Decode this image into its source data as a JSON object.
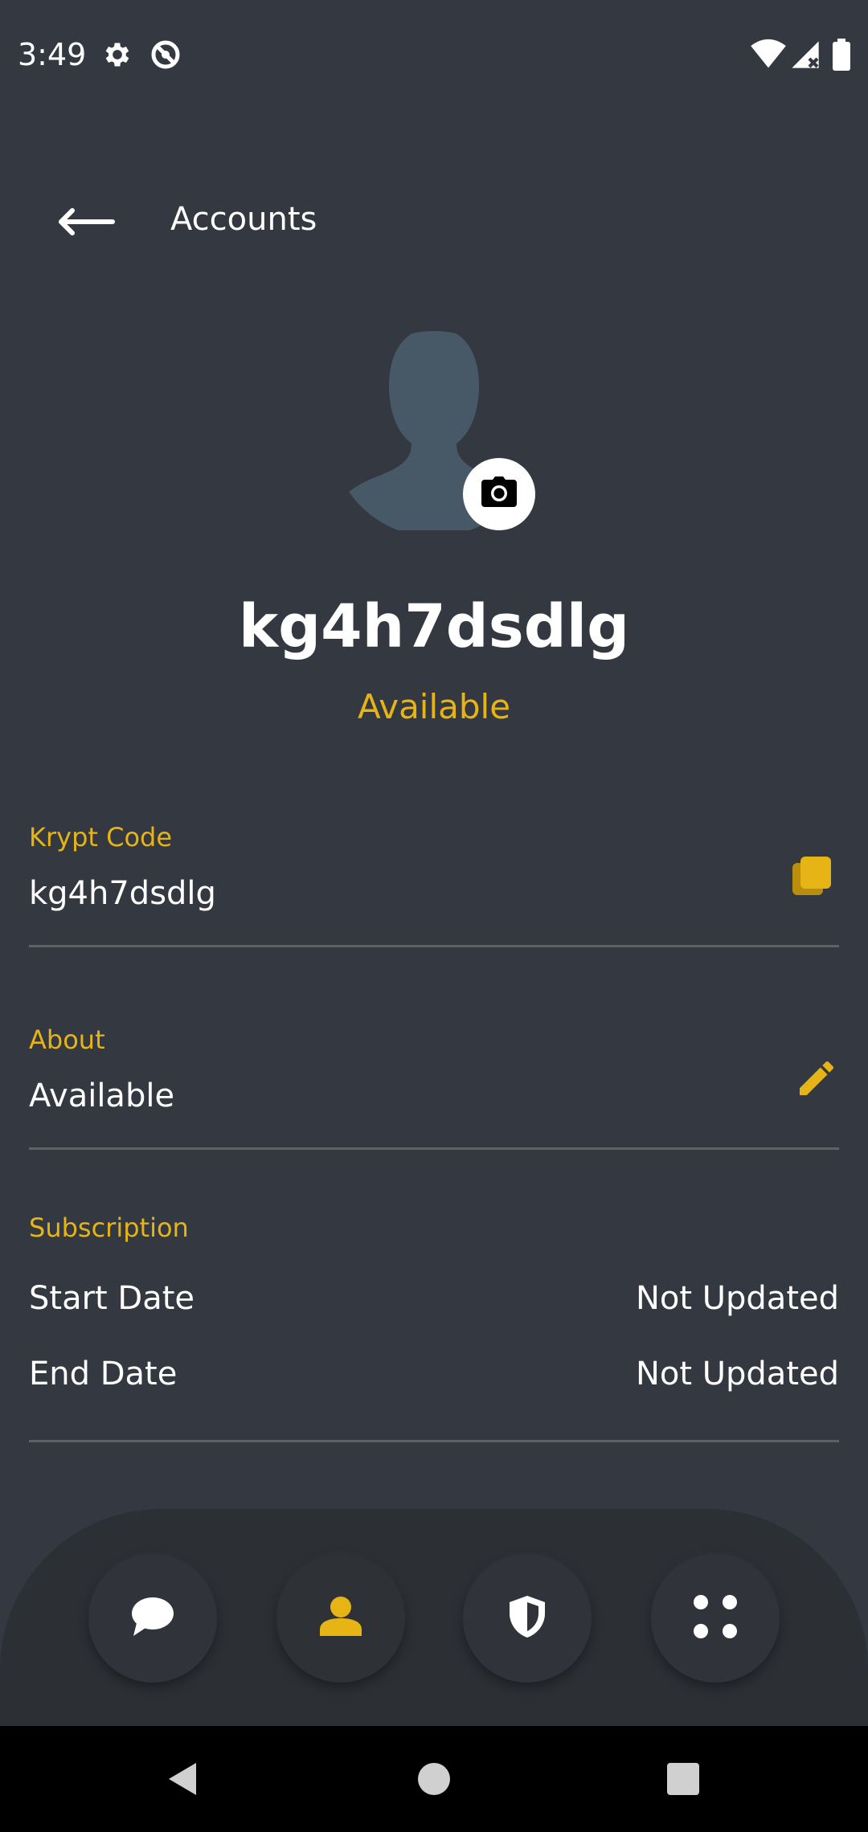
{
  "status_bar": {
    "time": "3:49",
    "icons_left": [
      "gear-icon",
      "no-signal-circle-icon"
    ],
    "icons_right": [
      "wifi-icon",
      "cell-signal-icon",
      "battery-icon"
    ]
  },
  "header": {
    "title": "Accounts",
    "back_icon": "arrow-left-icon"
  },
  "profile": {
    "name": "kg4h7dsdlg",
    "status": "Available",
    "avatar_icon": "person-silhouette-icon",
    "camera_icon": "camera-icon"
  },
  "krypt_code": {
    "label": "Krypt Code",
    "value": "kg4h7dsdlg",
    "action_icon": "copy-icon"
  },
  "about": {
    "label": "About",
    "value": "Available",
    "action_icon": "pencil-icon"
  },
  "subscription": {
    "label": "Subscription",
    "rows": [
      {
        "label": "Start Date",
        "value": "Not Updated"
      },
      {
        "label": "End Date",
        "value": "Not Updated"
      }
    ]
  },
  "bottom_nav": {
    "items": [
      {
        "icon": "chat-bubble-icon",
        "active": false
      },
      {
        "icon": "user-icon",
        "active": true
      },
      {
        "icon": "shield-icon",
        "active": false
      },
      {
        "icon": "apps-dots-icon",
        "active": false
      }
    ]
  },
  "system_nav": {
    "icons": [
      "back-triangle-icon",
      "home-circle-icon",
      "recents-square-icon"
    ]
  },
  "colors": {
    "background": "#343841",
    "accent": "#e7b415",
    "text": "#ffffff",
    "divider": "#5d6168",
    "nav_panel": "#2c2f34"
  }
}
